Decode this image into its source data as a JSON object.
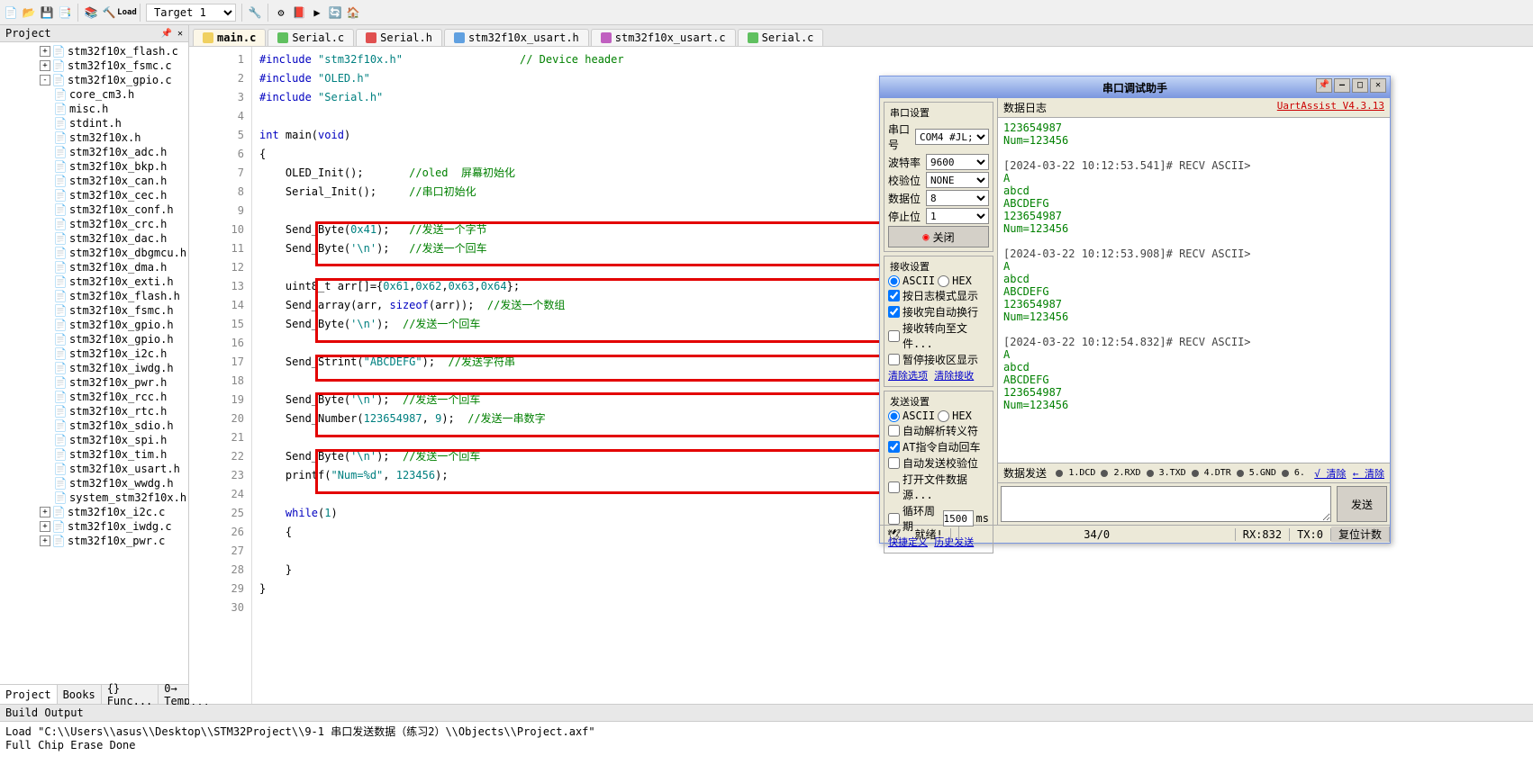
{
  "toolbar": {
    "target_label": "Target 1"
  },
  "project": {
    "panel_title": "Project",
    "tree": [
      {
        "lvl": 1,
        "exp": "+",
        "ico": "c",
        "label": "stm32f10x_flash.c"
      },
      {
        "lvl": 1,
        "exp": "+",
        "ico": "c",
        "label": "stm32f10x_fsmc.c"
      },
      {
        "lvl": 1,
        "exp": "-",
        "ico": "c",
        "label": "stm32f10x_gpio.c"
      },
      {
        "lvl": 2,
        "ico": "h",
        "label": "core_cm3.h"
      },
      {
        "lvl": 2,
        "ico": "h",
        "label": "misc.h"
      },
      {
        "lvl": 2,
        "ico": "h",
        "label": "stdint.h"
      },
      {
        "lvl": 2,
        "ico": "h",
        "label": "stm32f10x.h"
      },
      {
        "lvl": 2,
        "ico": "h",
        "label": "stm32f10x_adc.h"
      },
      {
        "lvl": 2,
        "ico": "h",
        "label": "stm32f10x_bkp.h"
      },
      {
        "lvl": 2,
        "ico": "h",
        "label": "stm32f10x_can.h"
      },
      {
        "lvl": 2,
        "ico": "h",
        "label": "stm32f10x_cec.h"
      },
      {
        "lvl": 2,
        "ico": "h",
        "label": "stm32f10x_conf.h"
      },
      {
        "lvl": 2,
        "ico": "h",
        "label": "stm32f10x_crc.h"
      },
      {
        "lvl": 2,
        "ico": "h",
        "label": "stm32f10x_dac.h"
      },
      {
        "lvl": 2,
        "ico": "h",
        "label": "stm32f10x_dbgmcu.h"
      },
      {
        "lvl": 2,
        "ico": "h",
        "label": "stm32f10x_dma.h"
      },
      {
        "lvl": 2,
        "ico": "h",
        "label": "stm32f10x_exti.h"
      },
      {
        "lvl": 2,
        "ico": "h",
        "label": "stm32f10x_flash.h"
      },
      {
        "lvl": 2,
        "ico": "h",
        "label": "stm32f10x_fsmc.h"
      },
      {
        "lvl": 2,
        "ico": "h",
        "label": "stm32f10x_gpio.h"
      },
      {
        "lvl": 2,
        "ico": "h",
        "label": "stm32f10x_gpio.h"
      },
      {
        "lvl": 2,
        "ico": "h",
        "label": "stm32f10x_i2c.h"
      },
      {
        "lvl": 2,
        "ico": "h",
        "label": "stm32f10x_iwdg.h"
      },
      {
        "lvl": 2,
        "ico": "h",
        "label": "stm32f10x_pwr.h"
      },
      {
        "lvl": 2,
        "ico": "h",
        "label": "stm32f10x_rcc.h"
      },
      {
        "lvl": 2,
        "ico": "h",
        "label": "stm32f10x_rtc.h"
      },
      {
        "lvl": 2,
        "ico": "h",
        "label": "stm32f10x_sdio.h"
      },
      {
        "lvl": 2,
        "ico": "h",
        "label": "stm32f10x_spi.h"
      },
      {
        "lvl": 2,
        "ico": "h",
        "label": "stm32f10x_tim.h"
      },
      {
        "lvl": 2,
        "ico": "h",
        "label": "stm32f10x_usart.h"
      },
      {
        "lvl": 2,
        "ico": "h",
        "label": "stm32f10x_wwdg.h"
      },
      {
        "lvl": 2,
        "ico": "h",
        "label": "system_stm32f10x.h"
      },
      {
        "lvl": 1,
        "exp": "+",
        "ico": "c",
        "label": "stm32f10x_i2c.c"
      },
      {
        "lvl": 1,
        "exp": "+",
        "ico": "c",
        "label": "stm32f10x_iwdg.c"
      },
      {
        "lvl": 1,
        "exp": "+",
        "ico": "c",
        "label": "stm32f10x_pwr.c"
      }
    ],
    "tabs": [
      {
        "label": "Project",
        "active": true
      },
      {
        "label": "Books"
      },
      {
        "label": "{} Func..."
      },
      {
        "label": "0→ Temp..."
      }
    ]
  },
  "editor": {
    "tabs": [
      {
        "label": "main.c",
        "active": true,
        "color": "#f0d060"
      },
      {
        "label": "Serial.c",
        "color": "#60c060"
      },
      {
        "label": "Serial.h",
        "color": "#e05050"
      },
      {
        "label": "stm32f10x_usart.h",
        "color": "#60a0e0"
      },
      {
        "label": "stm32f10x_usart.c",
        "color": "#c060c0"
      },
      {
        "label": "Serial.c",
        "color": "#60c060"
      }
    ],
    "code": [
      {
        "n": 1,
        "html": "<span class='kw'>#include</span> <span class='str'>\"stm32f10x.h\"</span>                  <span class='cmt'>// Device header</span>"
      },
      {
        "n": 2,
        "html": "<span class='kw'>#include</span> <span class='str'>\"OLED.h\"</span>"
      },
      {
        "n": 3,
        "html": "<span class='kw'>#include</span> <span class='str'>\"Serial.h\"</span>"
      },
      {
        "n": 4,
        "html": ""
      },
      {
        "n": 5,
        "html": "<span class='kw'>int</span> main(<span class='kw'>void</span>)"
      },
      {
        "n": 6,
        "html": "{"
      },
      {
        "n": 7,
        "html": "    OLED_Init();       <span class='cmt'>//oled  屏幕初始化</span>"
      },
      {
        "n": 8,
        "html": "    Serial_Init();     <span class='cmt'>//串口初始化</span>"
      },
      {
        "n": 9,
        "html": "    "
      },
      {
        "n": 10,
        "html": "    Send_Byte(<span class='num'>0x41</span>);   <span class='cmt'>//发送一个字节</span>"
      },
      {
        "n": 11,
        "html": "    Send_Byte(<span class='str'>'\\n'</span>);   <span class='cmt'>//发送一个回车</span>"
      },
      {
        "n": 12,
        "html": "    "
      },
      {
        "n": 13,
        "html": "    uint8_t arr[]={<span class='num'>0x61</span>,<span class='num'>0x62</span>,<span class='num'>0x63</span>,<span class='num'>0x64</span>};"
      },
      {
        "n": 14,
        "html": "    Send_array(arr, <span class='kw'>sizeof</span>(arr));  <span class='cmt'>//发送一个数组</span>"
      },
      {
        "n": 15,
        "html": "    Send_Byte(<span class='str'>'\\n'</span>);  <span class='cmt'>//发送一个回车</span>"
      },
      {
        "n": 16,
        "html": "    "
      },
      {
        "n": 17,
        "html": "    Send_Strint(<span class='str'>\"ABCDEFG\"</span>);  <span class='cmt'>//发送字符串</span>"
      },
      {
        "n": 18,
        "html": "    "
      },
      {
        "n": 19,
        "html": "    Send_Byte(<span class='str'>'\\n'</span>);  <span class='cmt'>//发送一个回车</span>"
      },
      {
        "n": 20,
        "html": "    Send_Number(<span class='num'>123654987</span>, <span class='num'>9</span>);  <span class='cmt'>//发送一串数字</span>"
      },
      {
        "n": 21,
        "html": "    "
      },
      {
        "n": 22,
        "html": "    Send_Byte(<span class='str'>'\\n'</span>);  <span class='cmt'>//发送一个回车</span>"
      },
      {
        "n": 23,
        "html": "    printf(<span class='str'>\"Num=%d\"</span>, <span class='num'>123456</span>);"
      },
      {
        "n": 24,
        "html": "    "
      },
      {
        "n": 25,
        "html": "    <span class='kw'>while</span>(<span class='num'>1</span>)"
      },
      {
        "n": 26,
        "html": "    {"
      },
      {
        "n": 27,
        "html": "        "
      },
      {
        "n": 28,
        "html": "    }"
      },
      {
        "n": 29,
        "html": "}"
      },
      {
        "n": 30,
        "html": ""
      }
    ]
  },
  "output": {
    "title": "Build Output",
    "lines": [
      "Load \"C:\\\\Users\\\\asus\\\\Desktop\\\\STM32Project\\\\9-1 串口发送数据（练习2）\\\\Objects\\\\Project.axf\"",
      "Full Chip Erase Done"
    ]
  },
  "serial": {
    "title": "串口调试助手",
    "brand": "UartAssist V4.3.13",
    "port_group": "串口设置",
    "port_label": "串口号",
    "port_val": "COM4 #JL;",
    "baud_label": "波特率",
    "baud_val": "9600",
    "parity_label": "校验位",
    "parity_val": "NONE",
    "data_label": "数据位",
    "data_val": "8",
    "stop_label": "停止位",
    "stop_val": "1",
    "close_btn": "关闭",
    "recv_group": "接收设置",
    "ascii": "ASCII",
    "hex": "HEX",
    "recv_opts": [
      "按日志模式显示",
      "接收完自动换行",
      "接收转向至文件...",
      "暂停接收区显示"
    ],
    "recv_links": [
      "清除选项",
      "清除接收"
    ],
    "send_group": "发送设置",
    "send_opts": [
      "自动解析转义符",
      "AT指令自动回车",
      "自动发送校验位",
      "打开文件数据源..."
    ],
    "loop_label": "循环周期",
    "loop_val": "1500",
    "loop_unit": "ms",
    "send_links": [
      "快捷定义",
      "历史发送"
    ],
    "log_title": "数据日志",
    "log": "123654987\nNum=123456\n\n[2024-03-22 10:12:53.541]# RECV ASCII>\nA\nabcd\nABCDEFG\n123654987\nNum=123456\n\n[2024-03-22 10:12:53.908]# RECV ASCII>\nA\nabcd\nABCDEFG\n123654987\nNum=123456\n\n[2024-03-22 10:12:54.832]# RECV ASCII>\nA\nabcd\nABCDEFG\n123654987\nNum=123456",
    "send_title": "数据发送",
    "signals": [
      "1.DCD",
      "2.RXD",
      "3.TXD",
      "4.DTR",
      "5.GND",
      "6."
    ],
    "clear1": "√ 清除",
    "clear2": "← 清除",
    "send_btn": "发送",
    "status": {
      "ready": "就绪!",
      "count": "34/0",
      "rx": "RX:832",
      "tx": "TX:0",
      "reset": "复位计数"
    }
  }
}
